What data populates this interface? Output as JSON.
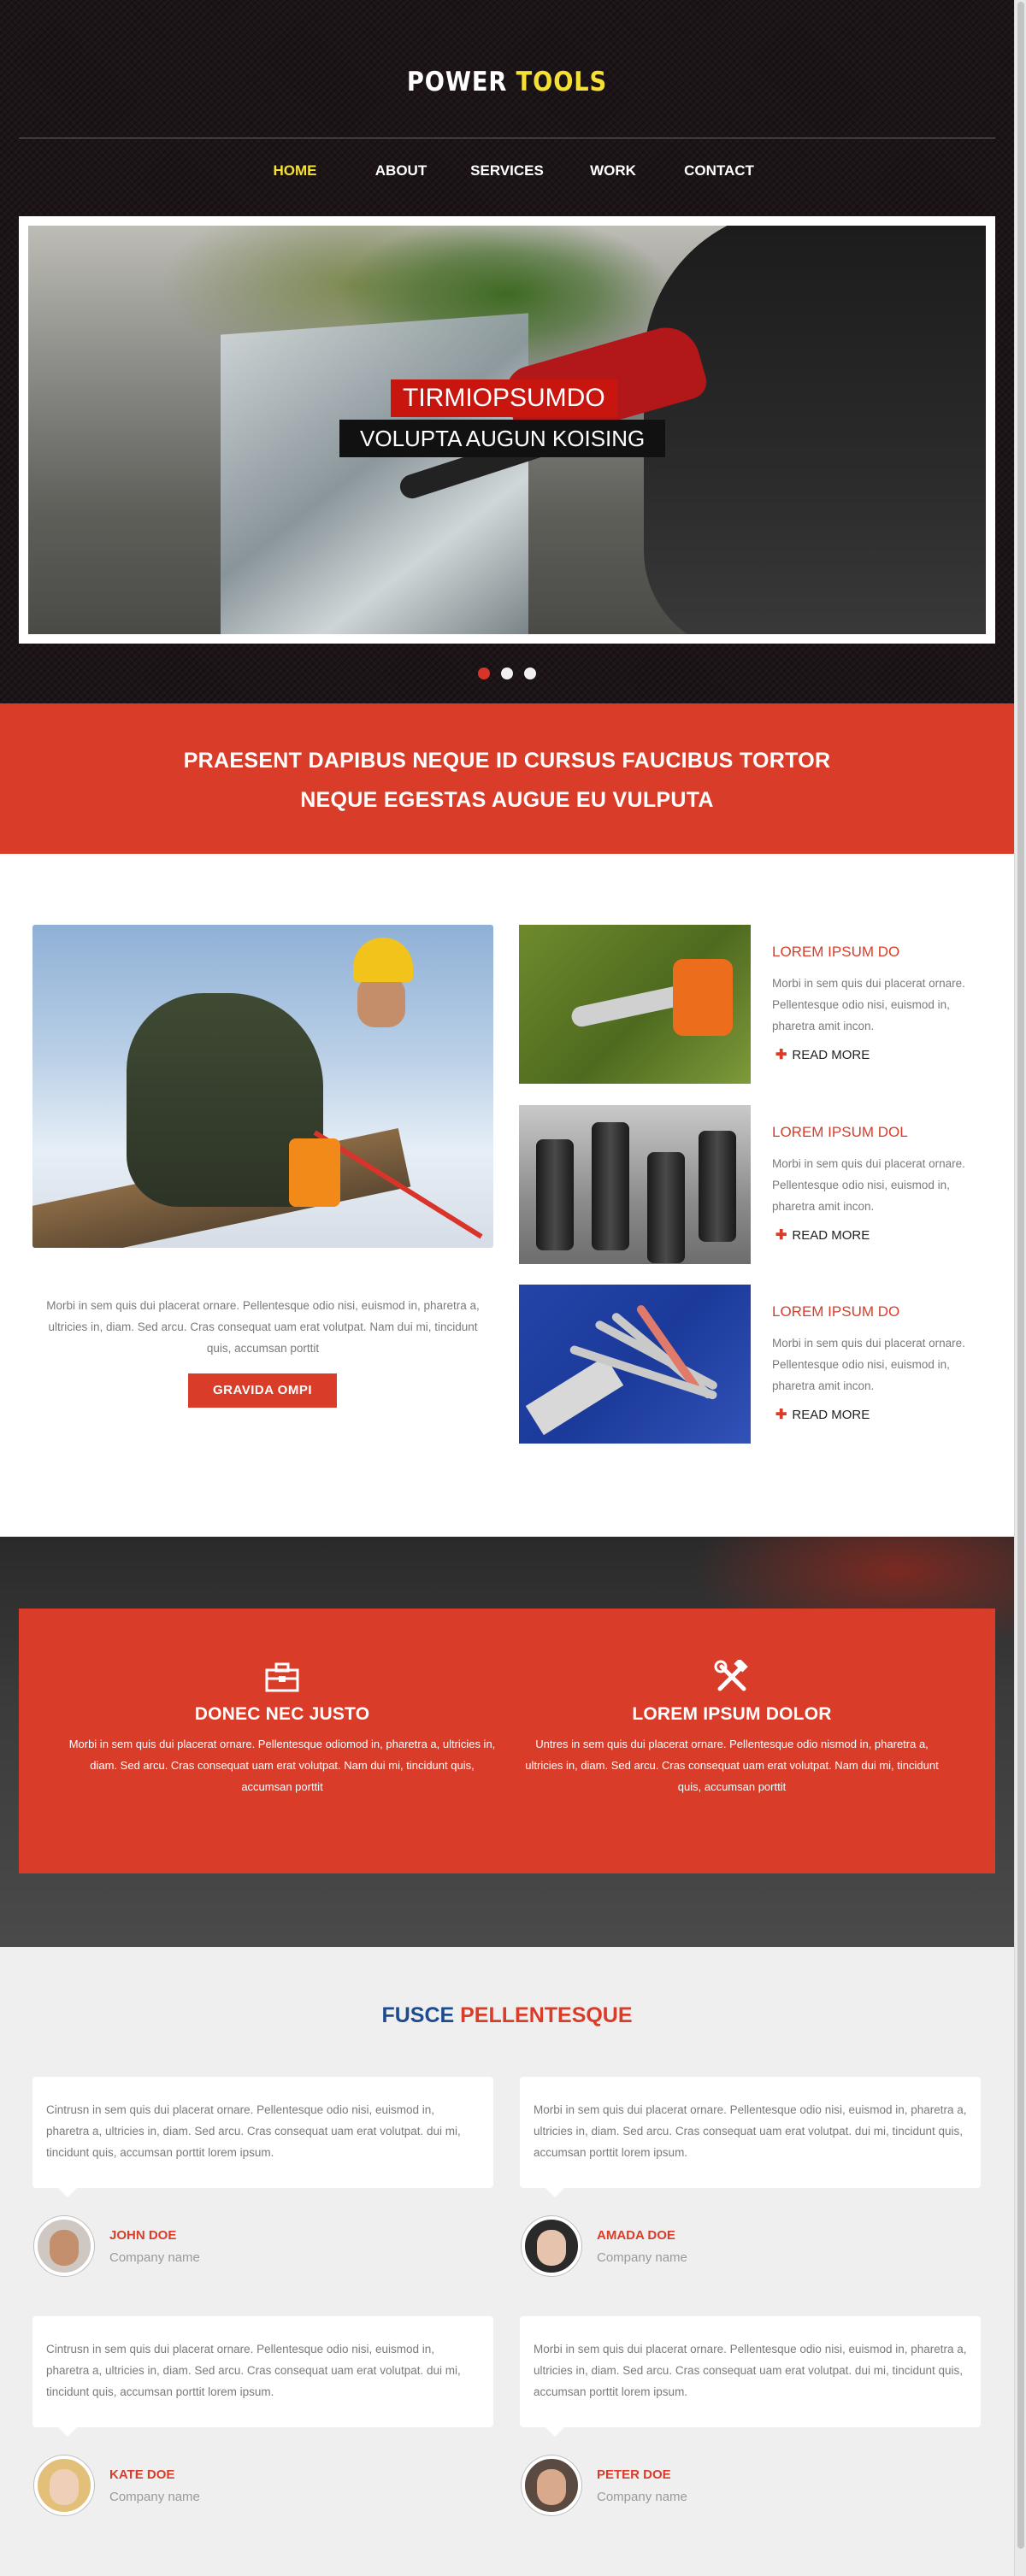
{
  "header": {
    "logo_part1": "POWER",
    "logo_part2": "TOOLS",
    "nav": [
      {
        "label": "HOME",
        "active": true
      },
      {
        "label": "ABOUT",
        "active": false
      },
      {
        "label": "SERVICES",
        "active": false
      },
      {
        "label": "WORK",
        "active": false
      },
      {
        "label": "CONTACT",
        "active": false
      }
    ]
  },
  "slider": {
    "caption_title": "TIRMIOPSUMDO",
    "caption_subtitle": "VOLUPTA AUGUN KOISING",
    "dots": 3,
    "active_dot": 0
  },
  "banner": {
    "line1": "PRAESENT DAPIBUS NEQUE ID CURSUS FAUCIBUS TORTOR",
    "line2": "NEQUE EGESTAS AUGUE EU VULPUTA"
  },
  "feature": {
    "text": "Morbi in sem quis dui placerat ornare. Pellentesque odio nisi, euismod in, pharetra a, ultricies in, diam. Sed arcu. Cras consequat uam erat volutpat. Nam dui mi, tincidunt quis, accumsan porttit",
    "button_label": "GRAVIDA OMPI"
  },
  "services": [
    {
      "title": "LOREM IPSUM DO",
      "text": "Morbi in sem quis dui placerat ornare. Pellentesque odio nisi, euismod in, pharetra amit incon.",
      "more": "READ MORE",
      "icon": "chainsaw-image"
    },
    {
      "title": "LOREM IPSUM DOL",
      "text": "Morbi in sem quis dui placerat ornare. Pellentesque odio nisi, euismod in, pharetra amit incon.",
      "more": "READ MORE",
      "icon": "drill-bits-image"
    },
    {
      "title": "LOREM IPSUM DO",
      "text": "Morbi in sem quis dui placerat ornare. Pellentesque odio nisi, euismod in, pharetra amit incon.",
      "more": "READ MORE",
      "icon": "hand-tools-image"
    }
  ],
  "highlights": [
    {
      "icon": "toolbox-icon",
      "title": "DONEC NEC JUSTO",
      "text": "Morbi in sem quis dui placerat ornare. Pellentesque odiomod in, pharetra a, ultricies in, diam. Sed arcu. Cras consequat uam erat volutpat. Nam dui mi, tincidunt quis, accumsan porttit"
    },
    {
      "icon": "hammer-wrench-icon",
      "title": "LOREM IPSUM DOLOR",
      "text": "Untres in sem quis dui placerat ornare. Pellentesque odio nismod in, pharetra a, ultricies in, diam. Sed arcu. Cras consequat uam erat volutpat. Nam dui mi, tincidunt quis, accumsan porttit"
    }
  ],
  "testimonials": {
    "title_part1": "FUSCE",
    "title_part2": "PELLENTESQUE",
    "items": [
      {
        "text": "Cintrusn in sem quis dui placerat ornare. Pellentesque odio nisi, euismod in, pharetra a, ultricies in, diam. Sed arcu. Cras consequat uam erat volutpat. dui mi, tincidunt quis, accumsan porttit lorem ipsum.",
        "name": "JOHN DOE",
        "company": "Company name"
      },
      {
        "text": "Morbi in sem quis dui placerat ornare. Pellentesque odio nisi, euismod in, pharetra a, ultricies in, diam. Sed arcu. Cras consequat uam erat volutpat. dui mi, tincidunt quis, accumsan porttit lorem ipsum.",
        "name": "AMADA DOE",
        "company": "Company name"
      },
      {
        "text": "Cintrusn in sem quis dui placerat ornare. Pellentesque odio nisi, euismod in, pharetra a, ultricies in, diam. Sed arcu. Cras consequat uam erat volutpat. dui mi, tincidunt quis, accumsan porttit lorem ipsum.",
        "name": "KATE DOE",
        "company": "Company name"
      },
      {
        "text": "Morbi in sem quis dui placerat ornare. Pellentesque odio nisi, euismod in, pharetra a, ultricies in, diam. Sed arcu. Cras consequat uam erat volutpat. dui mi, tincidunt quis, accumsan porttit lorem ipsum.",
        "name": "PETER DOE",
        "company": "Company name"
      }
    ]
  },
  "colors": {
    "accent_red": "#d93c29",
    "logo_yellow": "#f5e135",
    "title_blue": "#1c4c8e",
    "header_bg": "#1d1417"
  }
}
